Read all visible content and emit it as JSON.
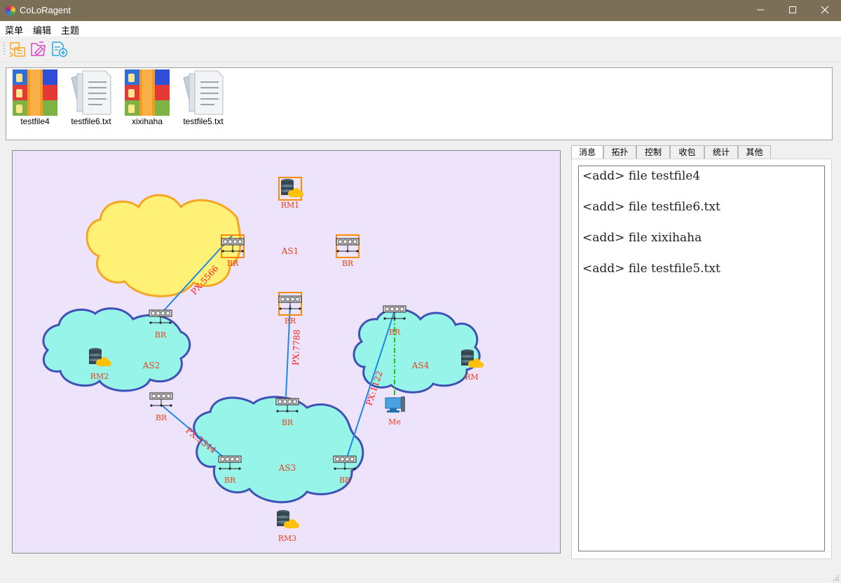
{
  "window": {
    "title": "CoLoRagent"
  },
  "menu": {
    "items": [
      "菜单",
      "编辑",
      "主题"
    ]
  },
  "toolbar": {
    "buttons": [
      "open-folder-icon",
      "edit-file-icon",
      "add-file-icon"
    ]
  },
  "files": [
    {
      "name": "testfile4",
      "icon": "archive-icon"
    },
    {
      "name": "testfile6.txt",
      "icon": "text-doc-icon"
    },
    {
      "name": "xixihaha",
      "icon": "archive-icon"
    },
    {
      "name": "testfile5.txt",
      "icon": "text-doc-icon"
    }
  ],
  "topology": {
    "as": [
      "AS1",
      "AS2",
      "AS3",
      "AS4"
    ],
    "br_label": "BR",
    "rm_labels": {
      "rm1": "RM1",
      "rm2": "RM2",
      "rm3": "RM3",
      "rm4": "RM"
    },
    "me_label": "Me",
    "links": {
      "l1": "PX:5566",
      "l2": "PX:7788",
      "l3": "PX:3344",
      "l4": "PX:1122"
    },
    "colors": {
      "as1_fill": "#fff176",
      "as1_stroke": "#f5a623",
      "cyan_fill": "#96f5e8",
      "cyan_stroke": "#3f51b5",
      "link": "#1e88e5",
      "link_label": "#ff1a1a",
      "node_label": "#e8401c",
      "selected": "#ff8c00",
      "me_link": "#20c020"
    }
  },
  "tabs": [
    "消息",
    "拓扑",
    "控制",
    "收包",
    "统计",
    "其他"
  ],
  "messages": [
    "<add> file testfile4",
    "<add> file testfile6.txt",
    "<add> file xixihaha",
    "<add> file testfile5.txt"
  ]
}
